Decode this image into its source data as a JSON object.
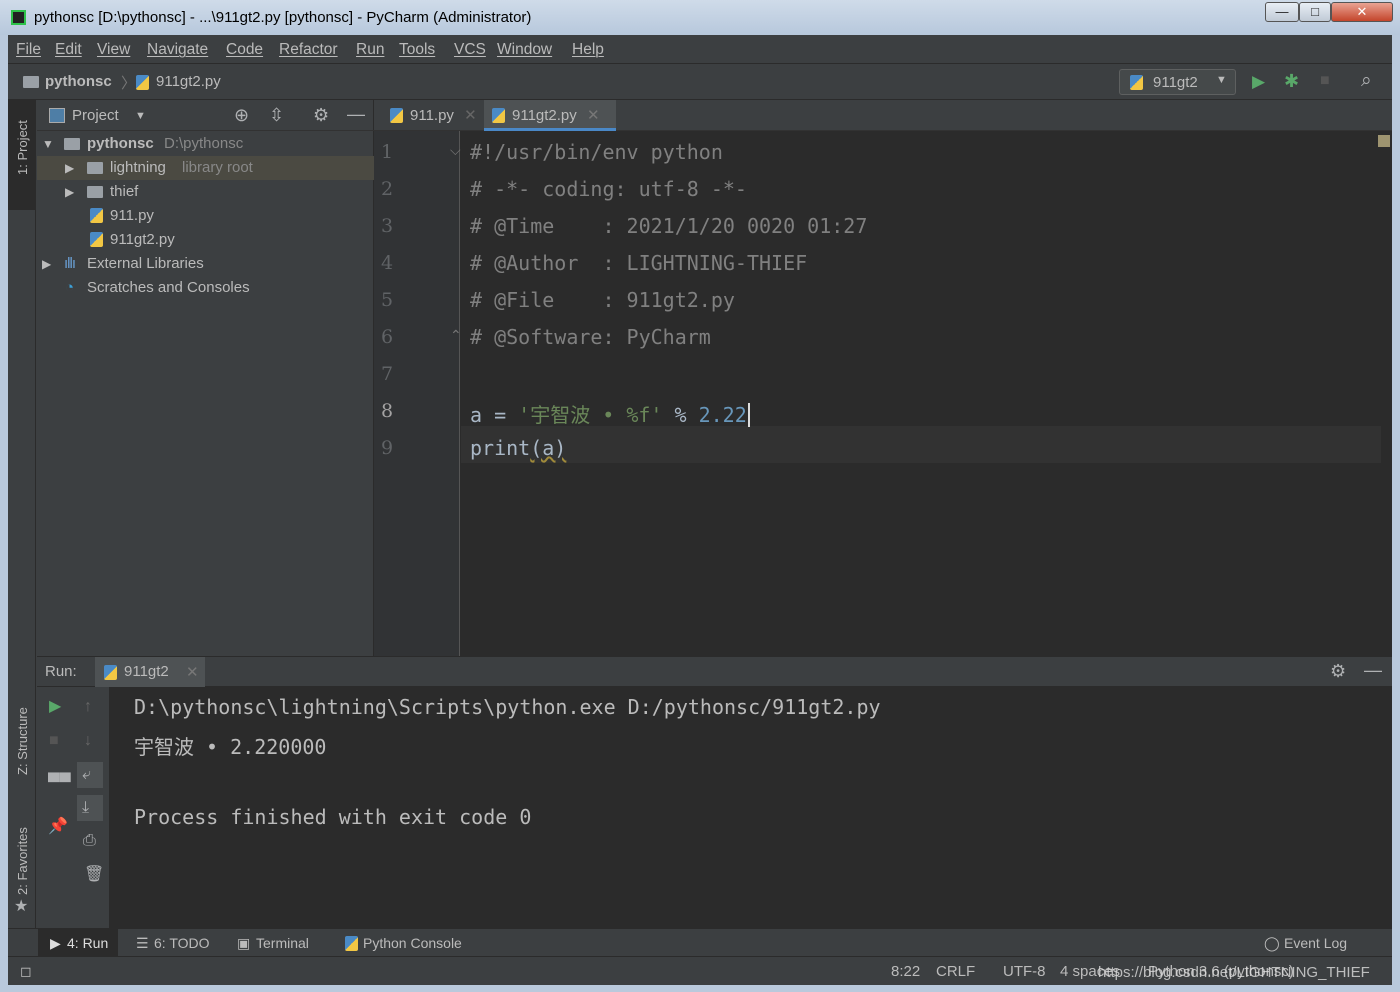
{
  "window": {
    "title": "pythonsc [D:\\pythonsc] - ...\\911gt2.py [pythonsc] - PyCharm (Administrator)"
  },
  "menu": [
    "File",
    "Edit",
    "View",
    "Navigate",
    "Code",
    "Refactor",
    "Run",
    "Tools",
    "VCS",
    "Window",
    "Help"
  ],
  "breadcrumb": {
    "project": "pythonsc",
    "file": "911gt2.py"
  },
  "run_config": "911gt2",
  "side_tabs": {
    "project": "1: Project",
    "structure": "Z: Structure",
    "favorites": "2: Favorites"
  },
  "project_panel": {
    "title": "Project",
    "tree": [
      {
        "label": "pythonsc",
        "hint": "D:\\pythonsc"
      },
      {
        "label": "lightning",
        "hint": "library root"
      },
      {
        "label": "thief",
        "hint": ""
      },
      {
        "label": "911.py",
        "hint": ""
      },
      {
        "label": "911gt2.py",
        "hint": ""
      },
      {
        "label": "External Libraries",
        "hint": ""
      },
      {
        "label": "Scratches and Consoles",
        "hint": ""
      }
    ]
  },
  "editor": {
    "tabs": [
      "911.py",
      "911gt2.py"
    ],
    "active_tab": "911gt2.py",
    "line_numbers": [
      "1",
      "2",
      "3",
      "4",
      "5",
      "6",
      "7",
      "8",
      "9"
    ],
    "lines": [
      "#!/usr/bin/env python",
      "# -*- coding: utf-8 -*-",
      "# @Time    : 2021/1/20 0020 01:27",
      "# @Author  : LIGHTNING-THIEF",
      "# @File    : 911gt2.py",
      "# @Software: PyCharm",
      "",
      "a = ",
      "'宇智波 • %f'",
      " % ",
      "2.22",
      "print",
      "(a)"
    ]
  },
  "run": {
    "label": "Run:",
    "tab": "911gt2",
    "output": [
      "D:\\pythonsc\\lightning\\Scripts\\python.exe D:/pythonsc/911gt2.py",
      "宇智波 • 2.220000",
      "",
      "Process finished with exit code 0"
    ]
  },
  "bottom_tabs": [
    "4: Run",
    "6: TODO",
    "Terminal",
    "Python Console"
  ],
  "event_log": "Event Log",
  "status": {
    "position": "8:22",
    "line_sep": "CRLF",
    "encoding": "UTF-8",
    "indent": "4 spaces",
    "interpreter": "Python 3.6 (pythonsc)"
  },
  "watermark": "https://blog.csdn.net/LIGHTNING_THIEF"
}
